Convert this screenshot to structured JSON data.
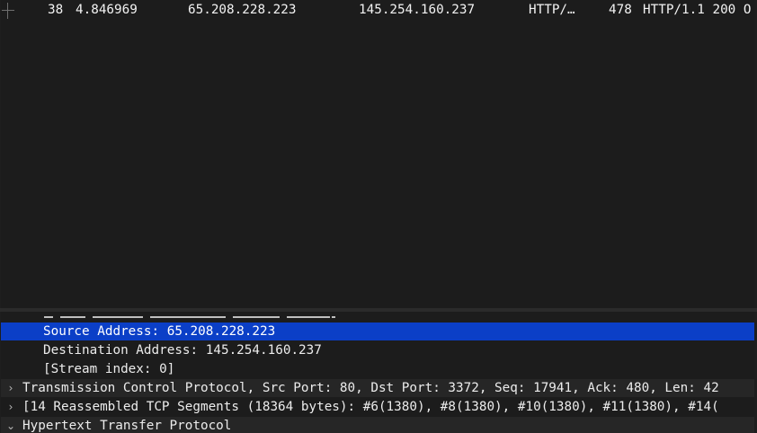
{
  "packet_list": {
    "rows": [
      {
        "no": "38",
        "time": "4.846969",
        "source": "65.208.228.223",
        "destination": "145.254.160.237",
        "protocol": "HTTP/…",
        "length": "478",
        "info": "HTTP/1.1 200 O"
      }
    ]
  },
  "details": {
    "lines": [
      {
        "text": "Source Address: 65.208.228.223",
        "selected": true
      },
      {
        "text": "Destination Address: 145.254.160.237"
      },
      {
        "text": "[Stream index: 0]"
      },
      {
        "text": "Transmission Control Protocol, Src Port: 80, Dst Port: 3372, Seq: 17941, Ack: 480, Len: 42",
        "toggle": "›"
      },
      {
        "text": "[14 Reassembled TCP Segments (18364 bytes): #6(1380), #8(1380), #10(1380), #11(1380), #14(",
        "toggle": "›"
      },
      {
        "text": "Hypertext Transfer Protocol",
        "toggle": "⌄"
      }
    ]
  },
  "colors": {
    "background": "#1c1c1c",
    "selection": "#0b3fc7",
    "text": "#ececec"
  }
}
